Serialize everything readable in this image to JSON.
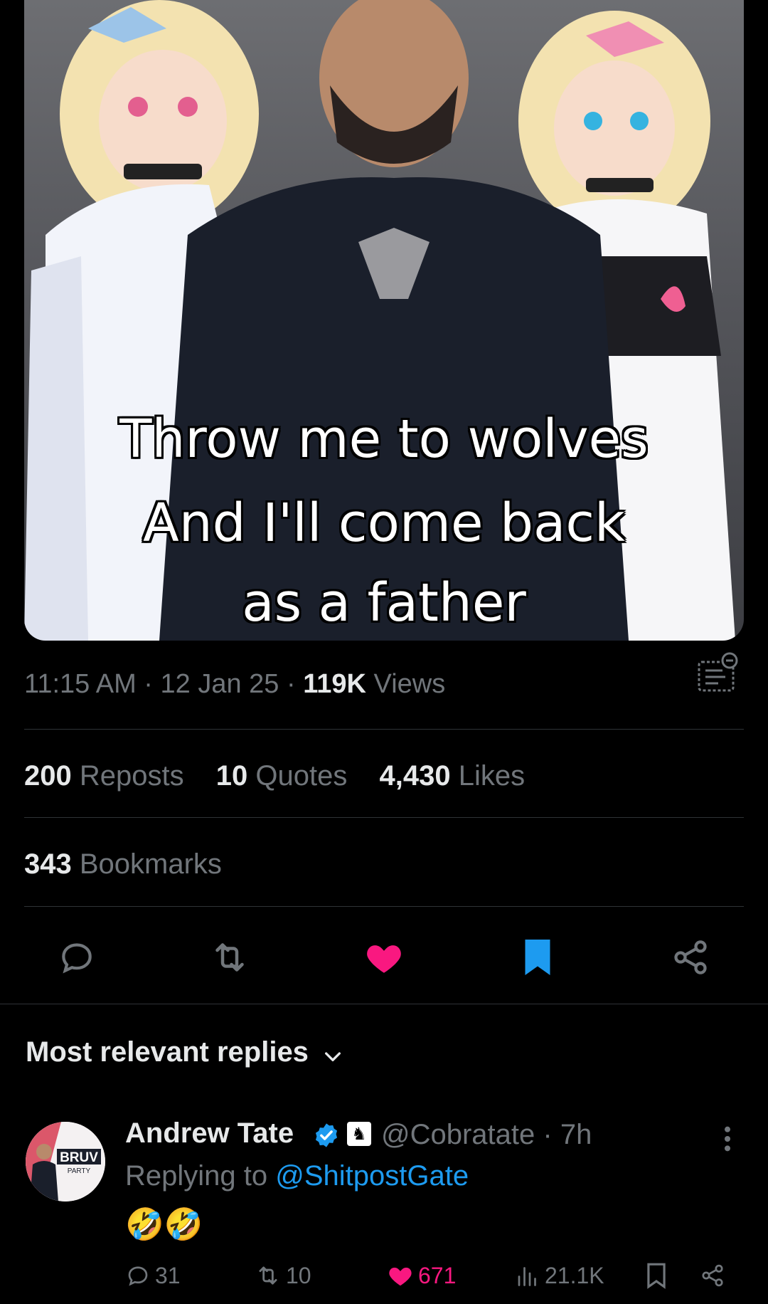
{
  "media": {
    "caption_lines": [
      "Throw me to wolves",
      "And I'll come back",
      "as a father"
    ]
  },
  "meta": {
    "time": "11:15 AM",
    "sep1": "·",
    "date": "12 Jan 25",
    "sep2": "·",
    "views_count": "119K",
    "views_label": "Views",
    "icon": "post-analytics-icon"
  },
  "stats": {
    "reposts_count": "200",
    "reposts_label": "Reposts",
    "quotes_count": "10",
    "quotes_label": "Quotes",
    "likes_count": "4,430",
    "likes_label": "Likes",
    "bookmarks_count": "343",
    "bookmarks_label": "Bookmarks"
  },
  "actions": {
    "reply_icon": "reply-icon",
    "repost_icon": "repost-icon",
    "like_icon": "heart-icon",
    "bookmark_icon": "bookmark-icon",
    "share_icon": "share-icon"
  },
  "colors": {
    "accent": "#1d9bf0",
    "like": "#f91880",
    "muted": "#71767b",
    "text": "#e7e9ea",
    "background": "#000000"
  },
  "replies": {
    "header": "Most relevant replies",
    "items": [
      {
        "name": "Andrew Tate",
        "handle": "@Cobratate",
        "sep": "·",
        "time": "7h",
        "replying_prefix": "Replying to",
        "replying_to": "@ShitpostGate",
        "content": "🤣🤣",
        "avatar_text": "BRUV",
        "avatar_subtext": "PARTY",
        "replies": "31",
        "reposts": "10",
        "likes": "671",
        "views": "21.1K"
      }
    ]
  }
}
